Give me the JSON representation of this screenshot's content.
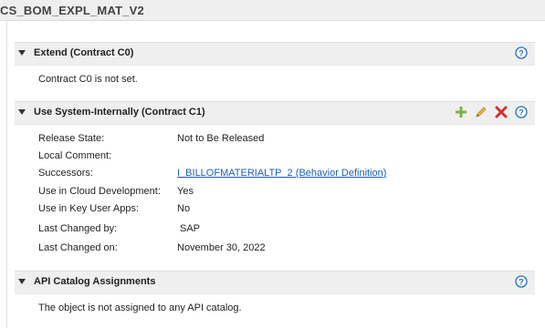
{
  "window": {
    "title": "CS_BOM_EXPL_MAT_V2"
  },
  "sections": [
    {
      "title": "Extend (Contract C0)",
      "body": "Contract C0 is not set."
    },
    {
      "title": "Use System-Internally (Contract C1)",
      "fields": [
        {
          "label": "Release State:",
          "value": "Not to Be Released"
        },
        {
          "label": "Local Comment:",
          "value": ""
        },
        {
          "label": "Successors:",
          "value": "I_BILLOFMATERIALTP_2 (Behavior Definition)"
        },
        {
          "label": "Use in Cloud Development:",
          "value": "Yes"
        },
        {
          "label": "Use in Key User Apps:",
          "value": "No"
        },
        {
          "label": "Last Changed by:",
          "value": "SAP"
        },
        {
          "label": "Last Changed on:",
          "value": "November 30, 2022"
        }
      ],
      "actions": [
        "add-icon",
        "edit-icon",
        "delete-icon"
      ]
    },
    {
      "title": "API Catalog Assignments",
      "body": "The object is not assigned to any API catalog."
    }
  ],
  "colors": {
    "link": "#1a5fb4",
    "help": "#1f6fc7",
    "add": "#7cb342",
    "edit": "#d9a441",
    "delete": "#d32f2f"
  }
}
